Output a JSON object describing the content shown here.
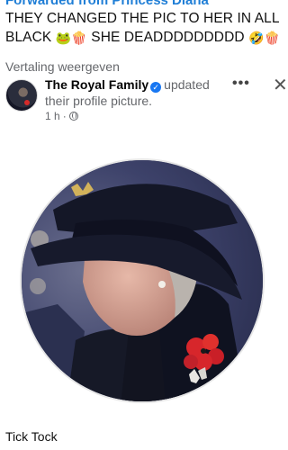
{
  "forward_line": "Forwarded from Princess Diana",
  "post": {
    "text_line1": "THEY CHANGED THE PIC TO HER IN ALL",
    "text_line2_a": "BLACK",
    "text_line2_b": "SHE DEADDDDDDDDD",
    "emoji_1": "frog-face",
    "emoji_2": "popcorn",
    "emoji_3": "rolling-laughing",
    "emoji_4": "popcorn"
  },
  "translate_link": "Vertaling weergeven",
  "share": {
    "page_name": "The Royal Family",
    "verified": true,
    "action_a": "updated",
    "action_b": "their profile picture.",
    "time": "1 h",
    "privacy_icon": "globe-icon"
  },
  "header_actions": {
    "more_label": "•••",
    "close_label": "✕"
  },
  "profile_photo_alt": "Profile picture",
  "caption": "Tick Tock",
  "colors": {
    "link_blue": "#1f7ed6",
    "secondary_text": "#65676b",
    "verified_blue": "#1877f2",
    "photo_bg": "#3a3f63",
    "poppy_red": "#d7262b"
  }
}
